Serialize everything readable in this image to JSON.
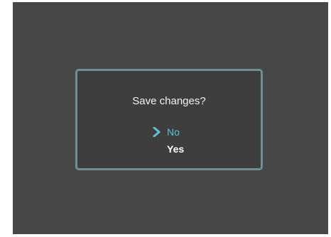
{
  "dialog": {
    "prompt": "Save changes?",
    "options": [
      {
        "label": "No",
        "selected": true
      },
      {
        "label": "Yes",
        "selected": false
      }
    ],
    "selection_icon": "chevron-right-icon"
  },
  "colors": {
    "screen_background": "#474747",
    "dialog_background": "#3e3e3e",
    "dialog_border": "#6e8f97",
    "selected_option": "#5bc3d6",
    "text": "#ffffff"
  }
}
